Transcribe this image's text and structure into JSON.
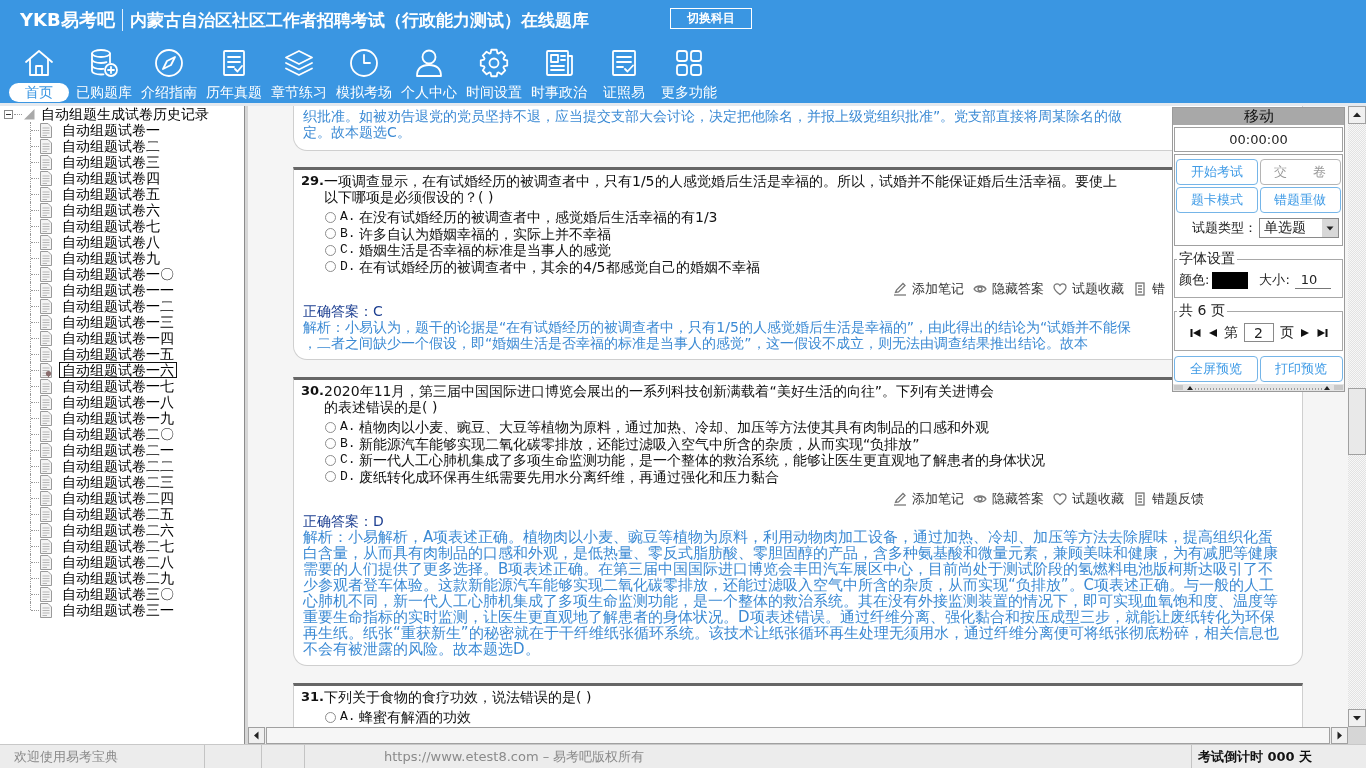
{
  "header": {
    "logo": "YKB易考吧",
    "title": "内蒙古自治区社区工作者招聘考试（行政能力测试）在线题库",
    "switch_button": "切换科目"
  },
  "nav": [
    {
      "label": "首页",
      "selected": true
    },
    {
      "label": "已购题库",
      "selected": false
    },
    {
      "label": "介绍指南",
      "selected": false
    },
    {
      "label": "历年真题",
      "selected": false
    },
    {
      "label": "章节练习",
      "selected": false
    },
    {
      "label": "模拟考场",
      "selected": false
    },
    {
      "label": "个人中心",
      "selected": false
    },
    {
      "label": "时间设置",
      "selected": false
    },
    {
      "label": "时事政治",
      "selected": false
    },
    {
      "label": "证照易",
      "selected": false
    },
    {
      "label": "更多功能",
      "selected": false
    }
  ],
  "tree": {
    "label": "自动组题生成试卷历史记录",
    "expanded": true,
    "children": [
      {
        "label": "自动组题试卷一",
        "selected": false
      },
      {
        "label": "自动组题试卷二",
        "selected": false
      },
      {
        "label": "自动组题试卷三",
        "selected": false
      },
      {
        "label": "自动组题试卷四",
        "selected": false
      },
      {
        "label": "自动组题试卷五",
        "selected": false
      },
      {
        "label": "自动组题试卷六",
        "selected": false
      },
      {
        "label": "自动组题试卷七",
        "selected": false
      },
      {
        "label": "自动组题试卷八",
        "selected": false
      },
      {
        "label": "自动组题试卷九",
        "selected": false
      },
      {
        "label": "自动组题试卷一〇",
        "selected": false
      },
      {
        "label": "自动组题试卷一一",
        "selected": false
      },
      {
        "label": "自动组题试卷一二",
        "selected": false
      },
      {
        "label": "自动组题试卷一三",
        "selected": false
      },
      {
        "label": "自动组题试卷一四",
        "selected": false
      },
      {
        "label": "自动组题试卷一五",
        "selected": false
      },
      {
        "label": "自动组题试卷一六",
        "selected": true
      },
      {
        "label": "自动组题试卷一七",
        "selected": false
      },
      {
        "label": "自动组题试卷一八",
        "selected": false
      },
      {
        "label": "自动组题试卷一九",
        "selected": false
      },
      {
        "label": "自动组题试卷二〇",
        "selected": false
      },
      {
        "label": "自动组题试卷二一",
        "selected": false
      },
      {
        "label": "自动组题试卷二二",
        "selected": false
      },
      {
        "label": "自动组题试卷二三",
        "selected": false
      },
      {
        "label": "自动组题试卷二四",
        "selected": false
      },
      {
        "label": "自动组题试卷二五",
        "selected": false
      },
      {
        "label": "自动组题试卷二六",
        "selected": false
      },
      {
        "label": "自动组题试卷二七",
        "selected": false
      },
      {
        "label": "自动组题试卷二八",
        "selected": false
      },
      {
        "label": "自动组题试卷二九",
        "selected": false
      },
      {
        "label": "自动组题试卷三〇",
        "selected": false
      },
      {
        "label": "自动组题试卷三一",
        "selected": false
      }
    ]
  },
  "questions": [
    {
      "analysis_lines": [
        "织批准。如被劝告退党的党员坚持不退，应当提交支部大会讨论，决定把他除名，并报上级党组织批准”。党支部直接将周某除名的做",
        "定。故本题选C。"
      ]
    },
    {
      "number": "29.",
      "stem_lines": [
        "一项调查显示，在有试婚经历的被调查者中，只有1/5的人感觉婚后生活是幸福的。所以，试婚并不能保证婚后生活幸福。要使上",
        "以下哪项是必须假设的？( )"
      ],
      "options": [
        {
          "letter": "A.",
          "text": "在没有试婚经历的被调查者中，感觉婚后生活幸福的有1/3",
          "selected": false
        },
        {
          "letter": "B.",
          "text": "许多自认为婚姻幸福的，实际上并不幸福",
          "selected": false
        },
        {
          "letter": "C.",
          "text": "婚姻生活是否幸福的标准是当事人的感觉",
          "selected": false
        },
        {
          "letter": "D.",
          "text": "在有试婚经历的被调查者中，其余的4/5都感觉自己的婚姻不幸福",
          "selected": false
        }
      ],
      "actions": [
        {
          "label": "添加笔记"
        },
        {
          "label": "隐藏答案"
        },
        {
          "label": "试题收藏"
        },
        {
          "label": "错"
        }
      ],
      "answer_label": "正确答案：",
      "answer": "C",
      "analysis_lines": [
        "解析：小易认为，题干的论据是“在有试婚经历的被调查者中，只有1/5的人感觉婚后生活是幸福的”，由此得出的结论为“试婚并不能保",
        "，二者之间缺少一个假设，即“婚姻生活是否幸福的标准是当事人的感觉”，这一假设不成立，则无法由调查结果推出结论。故本"
      ]
    },
    {
      "number": "30.",
      "stem_lines": [
        "2020年11月，第三届中国国际进口博览会展出的一系列科技创新满载着“美好生活的向往”。下列有关进博会",
        "的表述错误的是( )"
      ],
      "options": [
        {
          "letter": "A.",
          "text": "植物肉以小麦、豌豆、大豆等植物为原料，通过加热、冷却、加压等方法使其具有肉制品的口感和外观",
          "selected": false
        },
        {
          "letter": "B.",
          "text": "新能源汽车能够实现二氧化碳零排放，还能过滤吸入空气中所含的杂质，从而实现“负排放”",
          "selected": false
        },
        {
          "letter": "C.",
          "text": "新一代人工心肺机集成了多项生命监测功能，是一个整体的救治系统，能够让医生更直观地了解患者的身体状况",
          "selected": false
        },
        {
          "letter": "D.",
          "text": "废纸转化成环保再生纸需要先用水分离纤维，再通过强化和压力黏合",
          "selected": false
        }
      ],
      "actions": [
        {
          "label": "添加笔记"
        },
        {
          "label": "隐藏答案"
        },
        {
          "label": "试题收藏"
        },
        {
          "label": "错题反馈"
        }
      ],
      "answer_label": "正确答案：",
      "answer": "D",
      "analysis": "解析：小易解析，A项表述正确。植物肉以小麦、豌豆等植物为原料，利用动物肉加工设备，通过加热、冷却、加压等方法去除腥味，提高组织化蛋白含量，从而具有肉制品的口感和外观，是低热量、零反式脂肪酸、零胆固醇的产品，含多种氨基酸和微量元素，兼顾美味和健康，为有减肥等健康需要的人们提供了更多选择。B项表述正确。在第三届中国国际进口博览会丰田汽车展区中心，目前尚处于测试阶段的氢燃料电池版柯斯达吸引了不少参观者登车体验。这款新能源汽车能够实现二氧化碳零排放，还能过滤吸入空气中所含的杂质，从而实现“负排放”。C项表述正确。与一般的人工心肺机不同，新一代人工心肺机集成了多项生命监测功能，是一个整体的救治系统。其在没有外接监测装置的情况下，即可实现血氧饱和度、温度等重要生命指标的实时监测，让医生更直观地了解患者的身体状况。D项表述错误。通过纤维分离、强化黏合和按压成型三步，就能让废纸转化为环保再生纸。纸张“重获新生”的秘密就在于干纤维纸张循环系统。该技术让纸张循环再生处理无须用水，通过纤维分离便可将纸张彻底粉碎，相关信息也不会有被泄露的风险。故本题选D。"
    },
    {
      "number": "31.",
      "stem_lines": [
        "下列关于食物的食疗功效，说法错误的是( )"
      ],
      "options": [
        {
          "letter": "A.",
          "text": "蜂蜜有解酒的功效",
          "selected": false
        }
      ]
    }
  ],
  "tool_panel": {
    "title": "移动",
    "timer": "00:00:00",
    "buttons": [
      {
        "label": "开始考试",
        "disabled": false
      },
      {
        "label": "交　　卷",
        "disabled": true
      },
      {
        "label": "题卡模式",
        "disabled": false
      },
      {
        "label": "错题重做",
        "disabled": false
      }
    ],
    "type_label": "试题类型：",
    "type_value": "单选题",
    "font_group": {
      "legend": "字体设置",
      "color_label": "颜色:",
      "color": "#000000",
      "size_label": "大小:",
      "size": "10"
    },
    "pager": {
      "legend": "共 6 页",
      "prefix": "第",
      "page": "2",
      "suffix": "页"
    },
    "preview_buttons": [
      {
        "label": "全屏预览"
      },
      {
        "label": "打印预览"
      }
    ]
  },
  "status_bar": {
    "welcome": "欢迎使用易考宝典",
    "copyright": "https://www.etest8.com – 易考吧版权所有",
    "countdown": "考试倒计时 000 天"
  }
}
